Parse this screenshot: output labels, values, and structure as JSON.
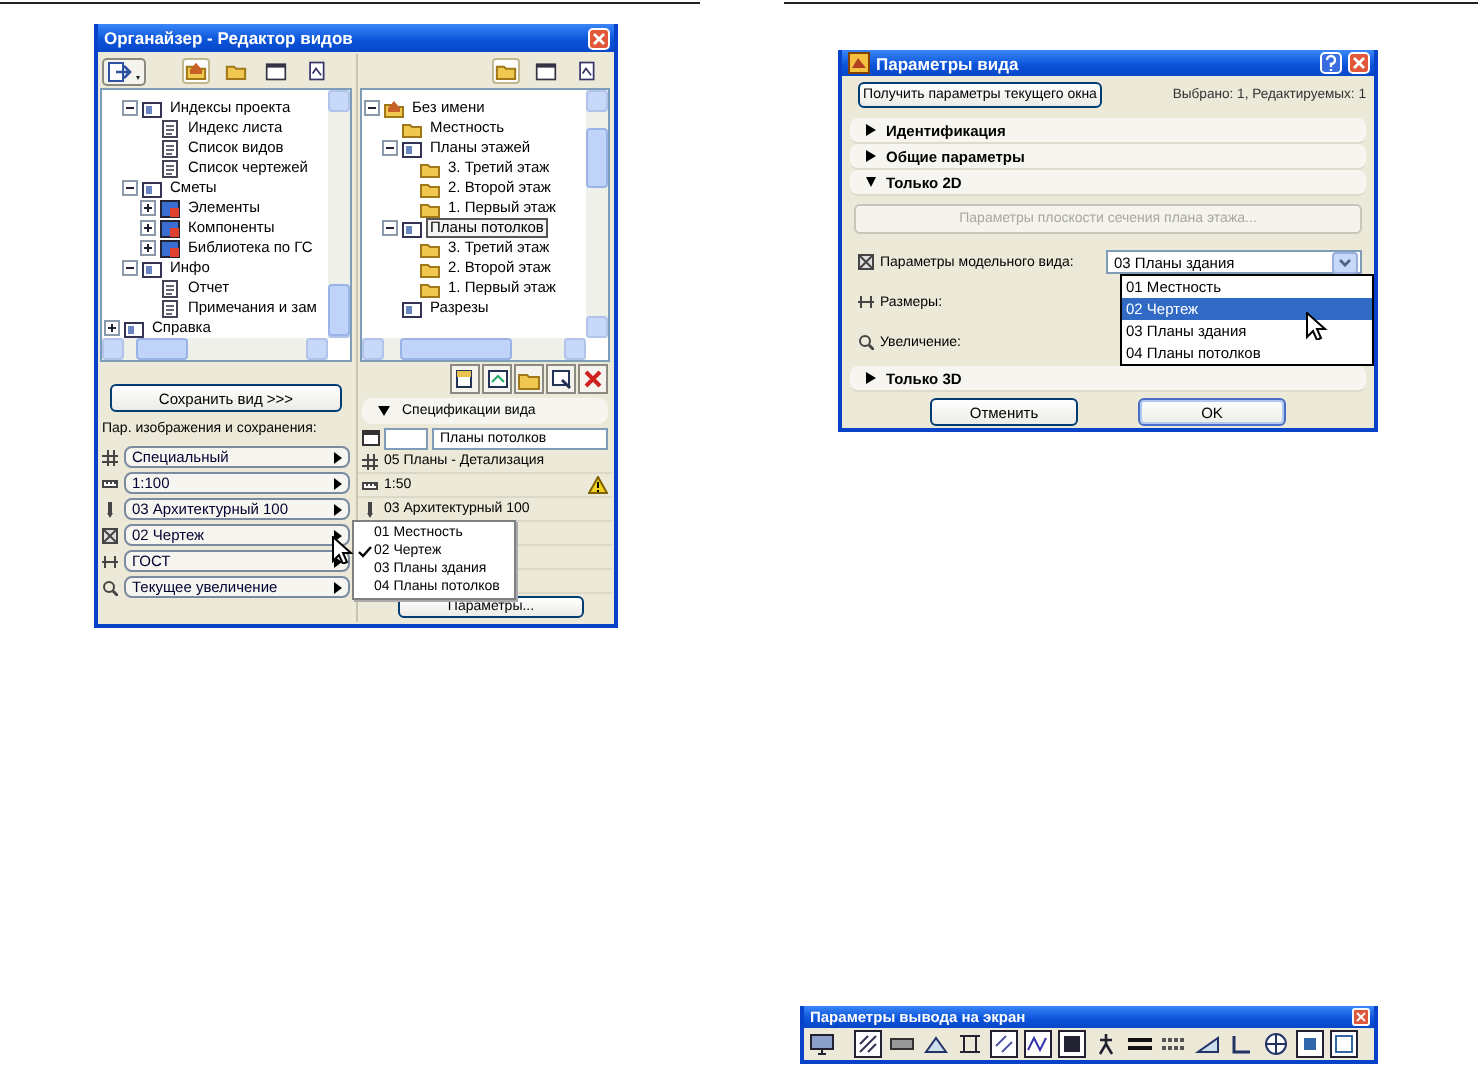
{
  "organizer": {
    "title": "Органайзер - Редактор видов",
    "left_tabs": [
      {
        "kind": "house",
        "selected": true
      },
      {
        "kind": "folder",
        "selected": false
      },
      {
        "kind": "window",
        "selected": false
      },
      {
        "kind": "layout",
        "selected": false
      }
    ],
    "right_tabs": [
      {
        "kind": "folder",
        "selected": true
      },
      {
        "kind": "window",
        "selected": false
      },
      {
        "kind": "layout",
        "selected": false
      }
    ],
    "left_tree": {
      "scrolled_children": [
        {
          "label": "Индексы проекта",
          "kind": "frame",
          "expanded": true,
          "children": [
            {
              "label": "Индекс листа",
              "kind": "doc"
            },
            {
              "label": "Список видов",
              "kind": "doc"
            },
            {
              "label": "Список чертежей",
              "kind": "doc"
            }
          ]
        },
        {
          "label": "Сметы",
          "kind": "frame",
          "expanded": true,
          "children": [
            {
              "label": "Элементы",
              "kind": "block",
              "expanded": false
            },
            {
              "label": "Компоненты",
              "kind": "block",
              "expanded": false
            },
            {
              "label": "Библиотека по ГС",
              "kind": "block",
              "expanded": false
            }
          ]
        },
        {
          "label": "Инфо",
          "kind": "frame",
          "expanded": true,
          "children": [
            {
              "label": "Отчет",
              "kind": "doc"
            },
            {
              "label": "Примечания и зам",
              "kind": "doc"
            }
          ]
        }
      ],
      "items": [
        {
          "label": "Справка",
          "kind": "frame",
          "expanded": false
        }
      ]
    },
    "right_tree": [
      {
        "label": "Без имени",
        "kind": "house",
        "expanded": true,
        "selected": false,
        "children": [
          {
            "label": "Местность",
            "kind": "folder",
            "selected": false
          },
          {
            "label": "Планы этажей",
            "kind": "frame",
            "expanded": true,
            "selected": false,
            "children": [
              {
                "label": "3. Третий этаж",
                "kind": "folder",
                "selected": false
              },
              {
                "label": "2. Второй этаж",
                "kind": "folder",
                "selected": false
              },
              {
                "label": "1. Первый этаж",
                "kind": "folder",
                "selected": false
              }
            ]
          },
          {
            "label": "Планы потолков",
            "kind": "frame",
            "expanded": true,
            "selected": true,
            "children": [
              {
                "label": "3. Третий этаж",
                "kind": "folder",
                "selected": false
              },
              {
                "label": "2. Второй этаж",
                "kind": "folder",
                "selected": false
              },
              {
                "label": "1. Первый этаж",
                "kind": "folder",
                "selected": false
              }
            ]
          },
          {
            "label": "Разрезы",
            "kind": "frame",
            "selected": false
          }
        ]
      }
    ],
    "save_button": "Сохранить вид >>>",
    "settings_label": "Пар. изображения и сохранения:",
    "settings": [
      {
        "kind": "layers",
        "value": "Специальный"
      },
      {
        "kind": "scale",
        "value": "1:100"
      },
      {
        "kind": "pen",
        "value": "03 Архитектурный 100"
      },
      {
        "kind": "model",
        "value": "02 Чертеж"
      },
      {
        "kind": "dims",
        "value": "ГОСТ"
      },
      {
        "kind": "zoom",
        "value": "Текущее увеличение"
      }
    ],
    "spec_header": "Спецификации вида",
    "view_name": "Планы потолков",
    "spec_rows": [
      {
        "kind": "layers",
        "text": "05 Планы - Детализация"
      },
      {
        "kind": "scale",
        "text": "1:50",
        "warning": true
      },
      {
        "kind": "pen",
        "text": "03 Архитектурный 100"
      }
    ],
    "params_button": "Параметры...",
    "popup_menu": [
      {
        "label": "01 Местность",
        "checked": false
      },
      {
        "label": "02 Чертеж",
        "checked": true
      },
      {
        "label": "03 Планы здания",
        "checked": false
      },
      {
        "label": "04 Планы потолков",
        "checked": false
      }
    ]
  },
  "view_settings": {
    "title": "Параметры вида",
    "get_button": "Получить параметры текущего окна",
    "selection_info": "Выбрано: 1, Редактируемых: 1",
    "sections": [
      {
        "label": "Идентификация",
        "expanded": false
      },
      {
        "label": "Общие параметры",
        "expanded": false
      },
      {
        "label": "Только 2D",
        "expanded": true,
        "cut_plane_button": {
          "label": "Параметры плоскости сечения плана этажа...",
          "disabled": true
        },
        "fields": [
          {
            "kind": "model",
            "label": "Параметры модельного вида:",
            "value": "03 Планы здания"
          },
          {
            "kind": "dims",
            "label": "Размеры:"
          },
          {
            "kind": "zoom",
            "label": "Увеличение:"
          }
        ]
      },
      {
        "label": "Только 3D",
        "expanded": false
      }
    ],
    "dropdown_list": [
      {
        "label": "01 Местность",
        "selected": false
      },
      {
        "label": "02 Чертеж",
        "selected": true
      },
      {
        "label": "03 Планы здания",
        "selected": false
      },
      {
        "label": "04 Планы потолков",
        "selected": false
      }
    ],
    "buttons": [
      {
        "label": "Отменить",
        "default": false
      },
      {
        "label": "OK",
        "default": true
      }
    ]
  },
  "display_toolbar": {
    "title": "Параметры вывода на экран"
  }
}
